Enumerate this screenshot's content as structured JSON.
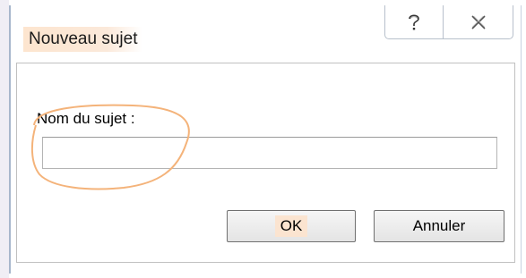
{
  "dialog": {
    "title": "Nouveau sujet",
    "help_label": "?",
    "close_label": "✕"
  },
  "form": {
    "field_label": "Nom du sujet :",
    "field_value": "",
    "field_placeholder": ""
  },
  "buttons": {
    "ok_label": "OK",
    "cancel_label": "Annuler"
  },
  "colors": {
    "title_highlight": "#fde5cf",
    "annotation_stroke": "#f4b37a",
    "window_border": "#a7b7cc"
  }
}
